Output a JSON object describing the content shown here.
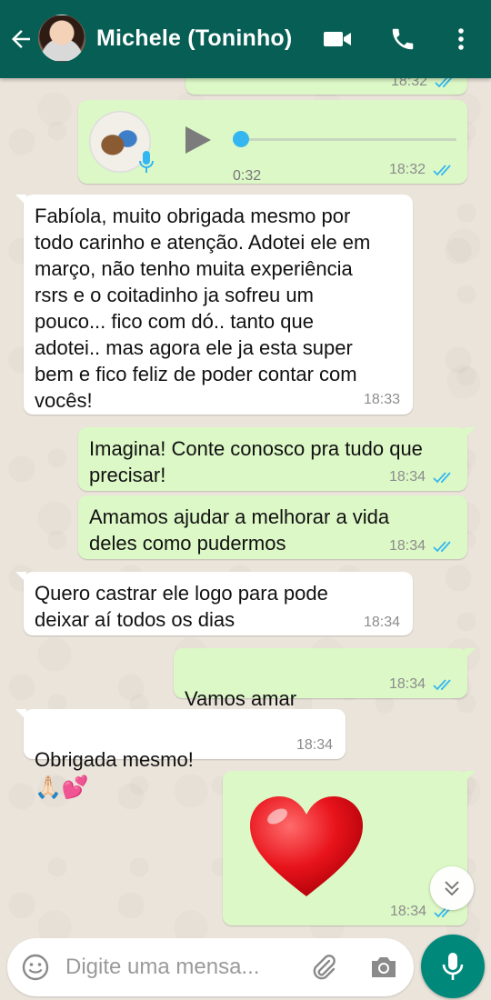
{
  "header": {
    "contact_name": "Michele (Toninho)",
    "icons": [
      "back-arrow-icon",
      "video-call-icon",
      "phone-icon",
      "more-options-icon"
    ],
    "color": "#075e54"
  },
  "messages": {
    "m0": {
      "time": "18:32"
    },
    "m1": {
      "duration": "0:32",
      "time": "18:32"
    },
    "m2": {
      "text": "Fabíola, muito obrigada mesmo por\ntodo carinho e atenção. Adotei ele em\nmarço, não tenho muita experiência\nrsrs e o coitadinho ja sofreu um\npouco... fico com dó.. tanto que\nadotei.. mas agora ele ja esta super\nbem e fico feliz de poder contar com\nvocês!",
      "time": "18:33"
    },
    "m3": {
      "text": "Imagina! Conte conosco pra tudo que\nprecisar!",
      "time": "18:34"
    },
    "m4": {
      "text": "Amamos ajudar a melhorar a vida\ndeles como pudermos",
      "time": "18:34"
    },
    "m5": {
      "text": "Quero castrar ele logo para pode\ndeixar aí todos os dias",
      "time": "18:34"
    },
    "m6": {
      "text": "Vamos amar",
      "emoji": "😍😍",
      "time": "18:34"
    },
    "m7": {
      "text": "Obrigada mesmo!",
      "emoji": "🙏🏻💕",
      "time": "18:34"
    },
    "m8": {
      "emoji": "❤️",
      "time": "18:34"
    }
  },
  "input": {
    "placeholder": "Digite uma mensa..."
  },
  "colors": {
    "outgoing": "#dcf8c6",
    "incoming": "#ffffff",
    "read_ticks": "#34b7f1",
    "send_button": "#00897b"
  }
}
